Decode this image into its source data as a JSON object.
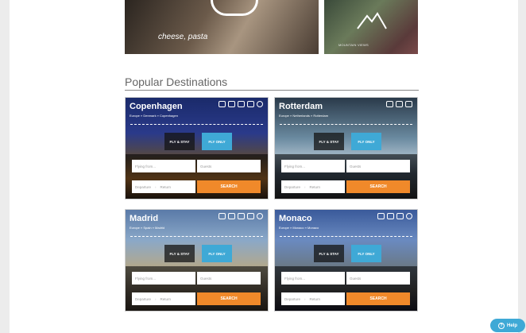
{
  "banners": {
    "left_caption": "cheese, pasta",
    "right_caption": "MOUNTAIN VIEWS"
  },
  "section": {
    "title": "Popular Destinations"
  },
  "destinations": [
    {
      "city": "Copenhagen",
      "breadcrumb": "Europe » Denmark » Copenhagen"
    },
    {
      "city": "Rotterdam",
      "breadcrumb": "Europe » Netherlands » Rotterdam"
    },
    {
      "city": "Madrid",
      "breadcrumb": "Europe » Spain » Madrid"
    },
    {
      "city": "Monaco",
      "breadcrumb": "Europe » Monaco » Monaco"
    }
  ],
  "form": {
    "tab_fly_stay": "FLY & STAY",
    "tab_fly_only": "FLY ONLY",
    "from_placeholder": "Flying from...",
    "guests_placeholder": "Guests",
    "departure": "Departure",
    "return": "Return",
    "search": "SEARCH"
  },
  "help": {
    "label": "Help",
    "icon": "?"
  },
  "colors": {
    "accent_blue": "#3fa9d6",
    "search_orange": "#f0892a"
  }
}
